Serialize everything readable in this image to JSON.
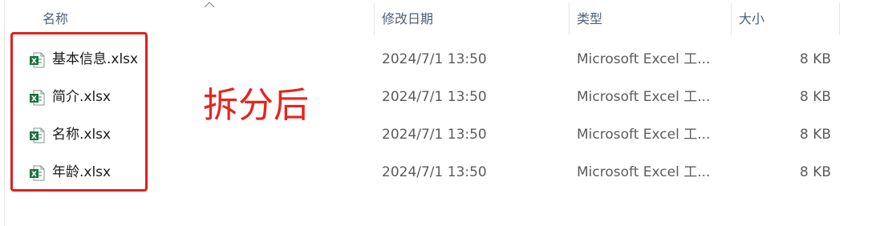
{
  "columns": {
    "name": "名称",
    "modified": "修改日期",
    "type": "类型",
    "size": "大小"
  },
  "files": [
    {
      "name": "基本信息.xlsx",
      "modified": "2024/7/1 13:50",
      "type": "Microsoft Excel 工...",
      "size": "8 KB",
      "icon": "excel-file-icon"
    },
    {
      "name": "简介.xlsx",
      "modified": "2024/7/1 13:50",
      "type": "Microsoft Excel 工...",
      "size": "8 KB",
      "icon": "excel-file-icon"
    },
    {
      "name": "名称.xlsx",
      "modified": "2024/7/1 13:50",
      "type": "Microsoft Excel 工...",
      "size": "8 KB",
      "icon": "excel-file-icon"
    },
    {
      "name": "年龄.xlsx",
      "modified": "2024/7/1 13:50",
      "type": "Microsoft Excel 工...",
      "size": "8 KB",
      "icon": "excel-file-icon"
    }
  ],
  "annotation": {
    "text": "拆分后",
    "color": "#e5251f"
  },
  "colors": {
    "header_text": "#4c607a",
    "excel_green": "#1e7145",
    "highlight_border": "#e0211d"
  }
}
